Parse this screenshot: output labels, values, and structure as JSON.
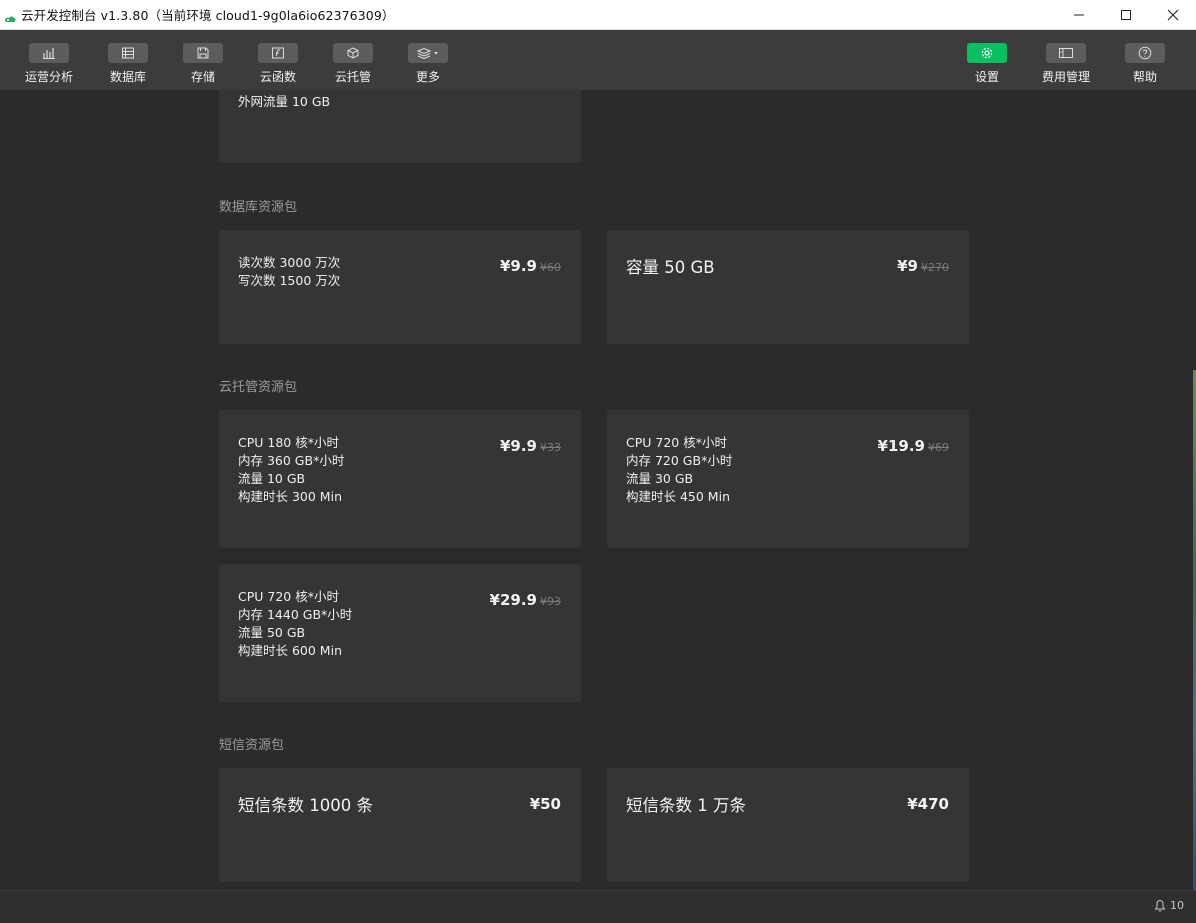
{
  "window": {
    "title": "云开发控制台 v1.3.80（当前环境 cloud1-9g0la6io62376309）"
  },
  "toolbar": {
    "left": [
      {
        "label": "运营分析",
        "icon": "bar-chart-icon"
      },
      {
        "label": "数据库",
        "icon": "database-icon"
      },
      {
        "label": "存储",
        "icon": "storage-icon"
      },
      {
        "label": "云函数",
        "icon": "function-icon"
      },
      {
        "label": "云托管",
        "icon": "cube-icon"
      },
      {
        "label": "更多",
        "icon": "layers-icon"
      }
    ],
    "right": [
      {
        "label": "设置",
        "icon": "gear-icon"
      },
      {
        "label": "费用管理",
        "icon": "billing-icon"
      },
      {
        "label": "帮助",
        "icon": "help-icon"
      }
    ]
  },
  "colors": {
    "accent": "#07c160",
    "background": "#2b2b2b",
    "card": "#353535",
    "toolbar": "#3c3c3c"
  },
  "partial_card": {
    "line": "外网流量 10 GB"
  },
  "sections": {
    "database": {
      "title": "数据库资源包",
      "cards": [
        {
          "lines": [
            "读次数 3000 万次",
            "写次数 1500 万次"
          ],
          "price": "¥9.9",
          "old_price": "¥60"
        },
        {
          "big": "容量 50 GB",
          "price": "¥9",
          "old_price": "¥270"
        }
      ]
    },
    "cloudrun": {
      "title": "云托管资源包",
      "cards": [
        {
          "lines": [
            "CPU 180 核*小时",
            "内存 360 GB*小时",
            "流量 10 GB",
            "构建时长 300 Min"
          ],
          "price": "¥9.9",
          "old_price": "¥33"
        },
        {
          "lines": [
            "CPU 720 核*小时",
            "内存 720 GB*小时",
            "流量 30 GB",
            "构建时长 450 Min"
          ],
          "price": "¥19.9",
          "old_price": "¥69"
        },
        {
          "lines": [
            "CPU 720 核*小时",
            "内存 1440 GB*小时",
            "流量 50 GB",
            "构建时长 600 Min"
          ],
          "price": "¥29.9",
          "old_price": "¥93"
        }
      ]
    },
    "sms": {
      "title": "短信资源包",
      "cards": [
        {
          "big": "短信条数 1000 条",
          "price": "¥50"
        },
        {
          "big": "短信条数 1 万条",
          "price": "¥470"
        }
      ]
    }
  },
  "status": {
    "notification_count": "10"
  }
}
